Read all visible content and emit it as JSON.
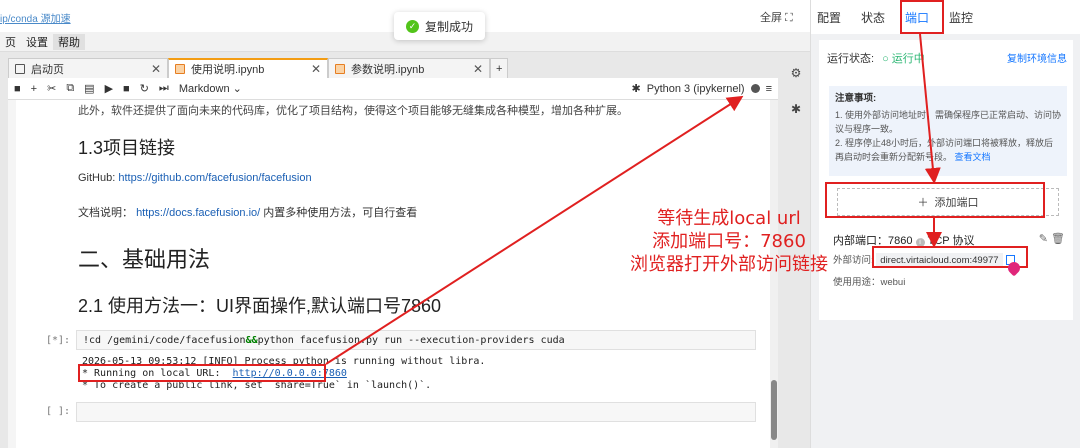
{
  "topbar": {
    "path": "ip/conda 源加速",
    "fullscreen": "全屏 ⛶"
  },
  "toast": {
    "text": "复制成功"
  },
  "menu": [
    "页",
    "设置",
    "帮助"
  ],
  "tabs": [
    {
      "label": "启动页"
    },
    {
      "label": "使用说明.ipynb"
    },
    {
      "label": "参数说明.ipynb"
    }
  ],
  "toolbar": {
    "cell_type": "Markdown",
    "kernel": "Python 3 (ipykernel)"
  },
  "doc": {
    "cut_line": "此外，软件还提供了面向未来的代码库，优化了项目结构，使得这个项目能够无缝集成各种模型，增加各种扩展。",
    "h3_links": "1.3项目链接",
    "github_label": "GitHub:",
    "github_url": "https://github.com/facefusion/facefusion",
    "docs_label": "文档说明：",
    "docs_url": "https://docs.facefusion.io/",
    "docs_suffix": "内置多种使用方法，可自行查看",
    "h2_usage": "二、基础用法",
    "h3_method": "2.1 使用方法一：UI界面操作,默认端口号7860"
  },
  "cell1": {
    "prompt": "[*]:",
    "code_pre": "!cd /gemini/code/facefusion",
    "code_op": "&&",
    "code_post": "python facefusion.py run --execution-providers cuda",
    "out1": "2026-05-13 09:53:12 [INFO] Process python is running without libra.",
    "out2_pre": "* Running on local URL:  ",
    "out2_url": "http://0.0.0.0:7860",
    "out3": "* To create a public link, set `share=True` in `launch()`."
  },
  "cell2": {
    "prompt": "[ ]:"
  },
  "panel": {
    "tabs": [
      "配置",
      "状态",
      "端口",
      "监控"
    ],
    "status_label": "运行状态:",
    "status_value": "○ 运行中",
    "copy_env": "复制环境信息",
    "notice_title": "注意事项:",
    "notice_1": "1. 使用外部访问地址时，需确保程序已正常启动、访问协议与程序一致。",
    "notice_2": "2. 程序停止48小时后，外部访问端口将被释放，释放后再启动时会重新分配新号段。",
    "notice_link": "查看文档",
    "add_port": "添加端口",
    "internal_port": "内部端口：7860",
    "protocol": "TCP 协议",
    "external_label": "外部访问:",
    "external_host": "direct.virtaicloud.com:49977",
    "usage": "使用用途：webui"
  },
  "annotation": {
    "line1": "等待生成local url",
    "line2": "添加端口号：7860",
    "line3": "浏览器打开外部访问链接"
  },
  "colors": {
    "accent": "#1677ff",
    "annotation": "#e02020",
    "running": "#2bb673"
  }
}
